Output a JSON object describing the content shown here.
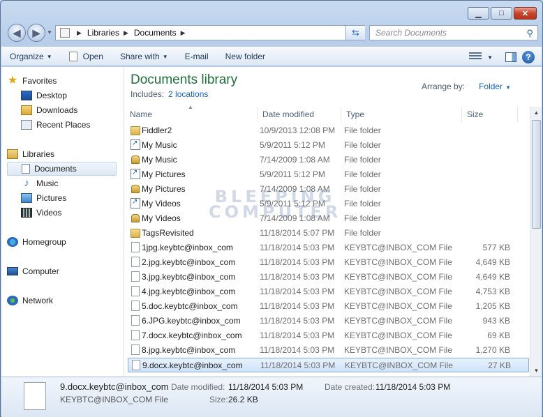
{
  "window": {
    "minimize": "▁",
    "maximize": "□",
    "close": "✕"
  },
  "nav": {
    "back": "◀",
    "forward": "▶",
    "breadcrumb": [
      "Libraries",
      "Documents"
    ],
    "search_placeholder": "Search Documents"
  },
  "toolbar": {
    "organize": "Organize",
    "open": "Open",
    "share_with": "Share with",
    "email": "E-mail",
    "new_folder": "New folder"
  },
  "sidebar": {
    "favorites": "Favorites",
    "desktop": "Desktop",
    "downloads": "Downloads",
    "recent_places": "Recent Places",
    "libraries": "Libraries",
    "documents": "Documents",
    "music": "Music",
    "pictures": "Pictures",
    "videos": "Videos",
    "homegroup": "Homegroup",
    "computer": "Computer",
    "network": "Network"
  },
  "library": {
    "title": "Documents library",
    "includes_label": "Includes:",
    "includes_link": "2 locations",
    "arrange_by_label": "Arrange by:",
    "arrange_by_value": "Folder"
  },
  "columns": {
    "name": "Name",
    "date_modified": "Date modified",
    "type": "Type",
    "size": "Size"
  },
  "files": [
    {
      "icon": "folder",
      "name": "Fiddler2",
      "date": "10/9/2013 12:08 PM",
      "type": "File folder",
      "size": ""
    },
    {
      "icon": "shortcut",
      "name": "My Music",
      "date": "5/9/2011 5:12 PM",
      "type": "File folder",
      "size": ""
    },
    {
      "icon": "locked",
      "name": "My Music",
      "date": "7/14/2009 1:08 AM",
      "type": "File folder",
      "size": ""
    },
    {
      "icon": "shortcut",
      "name": "My Pictures",
      "date": "5/9/2011 5:12 PM",
      "type": "File folder",
      "size": ""
    },
    {
      "icon": "locked",
      "name": "My Pictures",
      "date": "7/14/2009 1:08 AM",
      "type": "File folder",
      "size": ""
    },
    {
      "icon": "shortcut",
      "name": "My Videos",
      "date": "5/9/2011 5:12 PM",
      "type": "File folder",
      "size": ""
    },
    {
      "icon": "locked",
      "name": "My Videos",
      "date": "7/14/2009 1:08 AM",
      "type": "File folder",
      "size": ""
    },
    {
      "icon": "folder",
      "name": "TagsRevisited",
      "date": "11/18/2014 5:07 PM",
      "type": "File folder",
      "size": ""
    },
    {
      "icon": "file",
      "name": "1jpg.keybtc@inbox_com",
      "date": "11/18/2014 5:03 PM",
      "type": "KEYBTC@INBOX_COM File",
      "size": "577 KB"
    },
    {
      "icon": "file",
      "name": "2.jpg.keybtc@inbox_com",
      "date": "11/18/2014 5:03 PM",
      "type": "KEYBTC@INBOX_COM File",
      "size": "4,649 KB"
    },
    {
      "icon": "file",
      "name": "3.jpg.keybtc@inbox_com",
      "date": "11/18/2014 5:03 PM",
      "type": "KEYBTC@INBOX_COM File",
      "size": "4,649 KB"
    },
    {
      "icon": "file",
      "name": "4.jpg.keybtc@inbox_com",
      "date": "11/18/2014 5:03 PM",
      "type": "KEYBTC@INBOX_COM File",
      "size": "4,753 KB"
    },
    {
      "icon": "file",
      "name": "5.doc.keybtc@inbox_com",
      "date": "11/18/2014 5:03 PM",
      "type": "KEYBTC@INBOX_COM File",
      "size": "1,205 KB"
    },
    {
      "icon": "file",
      "name": "6.JPG.keybtc@inbox_com",
      "date": "11/18/2014 5:03 PM",
      "type": "KEYBTC@INBOX_COM File",
      "size": "943 KB"
    },
    {
      "icon": "file",
      "name": "7.docx.keybtc@inbox_com",
      "date": "11/18/2014 5:03 PM",
      "type": "KEYBTC@INBOX_COM File",
      "size": "69 KB"
    },
    {
      "icon": "file",
      "name": "8.jpg.keybtc@inbox_com",
      "date": "11/18/2014 5:03 PM",
      "type": "KEYBTC@INBOX_COM File",
      "size": "1,270 KB"
    },
    {
      "icon": "file",
      "name": "9.docx.keybtc@inbox_com",
      "date": "11/18/2014 5:03 PM",
      "type": "KEYBTC@INBOX_COM File",
      "size": "27 KB",
      "selected": true
    }
  ],
  "watermark": {
    "line1": "BLEEPING",
    "line2": "COMPUTER"
  },
  "details": {
    "name": "9.docx.keybtc@inbox_com",
    "type": "KEYBTC@INBOX_COM File",
    "date_modified_label": "Date modified:",
    "date_modified": "11/18/2014 5:03 PM",
    "date_created_label": "Date created:",
    "date_created": "11/18/2014 5:03 PM",
    "size_label": "Size:",
    "size": "26.2 KB"
  }
}
